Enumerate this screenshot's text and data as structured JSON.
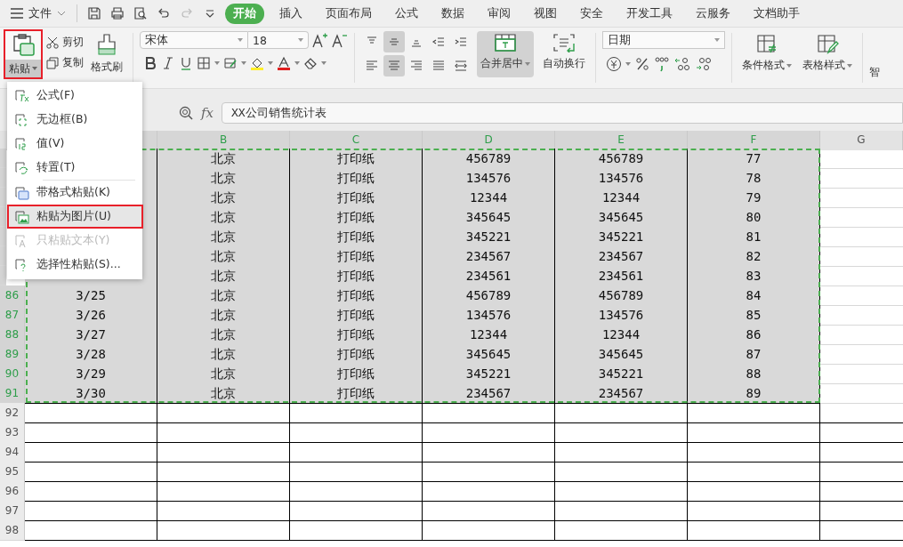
{
  "menu_bar": {
    "file_label": "文件",
    "tabs": [
      {
        "label": "开始",
        "selected": true
      },
      {
        "label": "插入",
        "selected": false
      },
      {
        "label": "页面布局",
        "selected": false
      },
      {
        "label": "公式",
        "selected": false
      },
      {
        "label": "数据",
        "selected": false
      },
      {
        "label": "审阅",
        "selected": false
      },
      {
        "label": "视图",
        "selected": false
      },
      {
        "label": "安全",
        "selected": false
      },
      {
        "label": "开发工具",
        "selected": false
      },
      {
        "label": "云服务",
        "selected": false
      },
      {
        "label": "文档助手",
        "selected": false
      }
    ]
  },
  "ribbon": {
    "paste": {
      "label": "粘贴",
      "highlighted": true
    },
    "cut": "剪切",
    "copy": "复制",
    "format_painter": "格式刷",
    "font": "宋体",
    "font_size": "18",
    "align_buttons": [
      {
        "kind": "top",
        "selected": false
      },
      {
        "kind": "middle",
        "selected": true
      },
      {
        "kind": "bottom",
        "selected": false
      },
      {
        "kind": "outdent",
        "selected": false
      },
      {
        "kind": "indent",
        "selected": false
      },
      {
        "kind": "left",
        "selected": false
      },
      {
        "kind": "center",
        "selected": true
      },
      {
        "kind": "right",
        "selected": false
      },
      {
        "kind": "justify",
        "selected": false
      },
      {
        "kind": "distribute",
        "selected": false
      }
    ],
    "merge": {
      "label": "合并居中",
      "selected": true
    },
    "wrap": "自动换行",
    "number_format": "日期",
    "conditional_format": "条件格式",
    "table_style": "表格样式",
    "cut_off_label": "智"
  },
  "formula_bar": {
    "fx": "fx",
    "value": "XX公司销售统计表"
  },
  "columns": [
    {
      "letter": "B",
      "selected": true
    },
    {
      "letter": "C",
      "selected": true
    },
    {
      "letter": "D",
      "selected": true
    },
    {
      "letter": "E",
      "selected": true
    },
    {
      "letter": "F",
      "selected": true
    },
    {
      "letter": "G",
      "selected": false
    }
  ],
  "rows": [
    {
      "selected": true,
      "cells": [
        "北京",
        "打印纸",
        "456789",
        "456789",
        "77"
      ]
    },
    {
      "selected": true,
      "cells": [
        "北京",
        "打印纸",
        "134576",
        "134576",
        "78"
      ]
    },
    {
      "selected": true,
      "cells": [
        "北京",
        "打印纸",
        "12344",
        "12344",
        "79"
      ]
    },
    {
      "selected": true,
      "cells": [
        "北京",
        "打印纸",
        "345645",
        "345645",
        "80"
      ]
    },
    {
      "selected": true,
      "cells": [
        "北京",
        "打印纸",
        "345221",
        "345221",
        "81"
      ]
    },
    {
      "selected": true,
      "cells": [
        "北京",
        "打印纸",
        "234567",
        "234567",
        "82"
      ]
    },
    {
      "selected": true,
      "cells": [
        "北京",
        "打印纸",
        "234561",
        "234561",
        "83"
      ]
    },
    {
      "number": "86",
      "selected": true,
      "cells": [
        "3/25",
        "北京",
        "打印纸",
        "456789",
        "456789",
        "84"
      ]
    },
    {
      "number": "87",
      "selected": true,
      "cells": [
        "3/26",
        "北京",
        "打印纸",
        "134576",
        "134576",
        "85"
      ]
    },
    {
      "number": "88",
      "selected": true,
      "cells": [
        "3/27",
        "北京",
        "打印纸",
        "12344",
        "12344",
        "86"
      ]
    },
    {
      "number": "89",
      "selected": true,
      "cells": [
        "3/28",
        "北京",
        "打印纸",
        "345645",
        "345645",
        "87"
      ]
    },
    {
      "number": "90",
      "selected": true,
      "cells": [
        "3/29",
        "北京",
        "打印纸",
        "345221",
        "345221",
        "88"
      ]
    },
    {
      "number": "91",
      "selected": true,
      "cells": [
        "3/30",
        "北京",
        "打印纸",
        "234567",
        "234567",
        "89"
      ]
    },
    {
      "number": "92",
      "selected": false,
      "cells": [
        "",
        "",
        "",
        "",
        "",
        ""
      ]
    },
    {
      "number": "93",
      "selected": false,
      "cells": [
        "",
        "",
        "",
        "",
        "",
        ""
      ]
    },
    {
      "number": "94",
      "selected": false,
      "cells": [
        "",
        "",
        "",
        "",
        "",
        ""
      ]
    },
    {
      "number": "95",
      "selected": false,
      "cells": [
        "",
        "",
        "",
        "",
        "",
        ""
      ]
    },
    {
      "number": "96",
      "selected": false,
      "cells": [
        "",
        "",
        "",
        "",
        "",
        ""
      ]
    },
    {
      "number": "97",
      "selected": false,
      "cells": [
        "",
        "",
        "",
        "",
        "",
        ""
      ]
    },
    {
      "number": "98",
      "selected": false,
      "cells": [
        "",
        "",
        "",
        "",
        "",
        ""
      ]
    }
  ],
  "paste_menu": {
    "items": [
      {
        "kind": "formula",
        "label": "公式(F)",
        "disabled": false,
        "highlighted": false
      },
      {
        "kind": "noborder",
        "label": "无边框(B)",
        "disabled": false,
        "highlighted": false
      },
      {
        "kind": "value",
        "label": "值(V)",
        "disabled": false,
        "highlighted": false
      },
      {
        "kind": "transpose",
        "label": "转置(T)",
        "disabled": false,
        "highlighted": false
      },
      {
        "kind": "format",
        "label": "带格式粘贴(K)",
        "disabled": false,
        "highlighted": false,
        "separator_before": true
      },
      {
        "kind": "picture",
        "label": "粘贴为图片(U)",
        "disabled": false,
        "highlighted": true
      },
      {
        "kind": "text",
        "label": "只粘贴文本(Y)",
        "disabled": true,
        "highlighted": false
      },
      {
        "kind": "special",
        "label": "选择性粘贴(S)...",
        "disabled": false,
        "highlighted": false
      }
    ]
  }
}
